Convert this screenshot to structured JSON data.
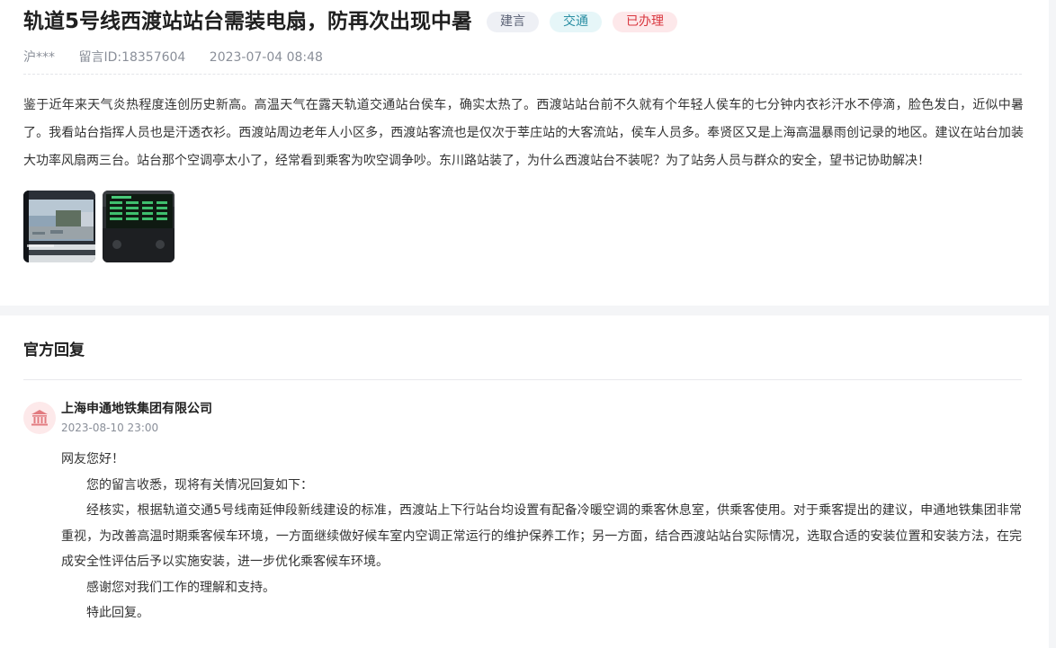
{
  "post": {
    "title": "轨道5号线西渡站站台需装电扇，防再次出现中暑",
    "tags": [
      "建言",
      "交通",
      "已办理"
    ],
    "author": "沪***",
    "message_id": "留言ID:18357604",
    "datetime": "2023-07-04 08:48",
    "content": "鉴于近年来天气炎热程度连创历史新高。高温天气在露天轨道交通站台侯车，确实太热了。西渡站站台前不久就有个年轻人侯车的七分钟内衣衫汗水不停滴，脸色发白，近似中暑了。我看站台指挥人员也是汗透衣衫。西渡站周边老年人小区多，西渡站客流也是仅次于莘庄站的大客流站，侯车人员多。奉贤区又是上海高温暴雨创记录的地区。建议在站台加装大功率风扇两三台。站台那个空调亭太小了，经常看到乘客为吹空调争吵。东川路站装了，为什么西渡站台不装呢？为了站务人员与群众的安全，望书记协助解决！",
    "images": [
      "station-window-photo",
      "station-display-photo"
    ]
  },
  "reply": {
    "section_title": "官方回复",
    "org_name": "上海申通地铁集团有限公司",
    "org_icon": "building-icon",
    "date": "2023-08-10 23:00",
    "paragraphs": [
      "网友您好！",
      "您的留言收悉，现将有关情况回复如下：",
      "经核实，根据轨道交通5号线南延伸段新线建设的标准，西渡站上下行站台均设置有配备冷暖空调的乘客休息室，供乘客使用。对于乘客提出的建议，申通地铁集团非常重视，为改善高温时期乘客候车环境，一方面继续做好候车室内空调正常运行的维护保养工作；另一方面，结合西渡站站台实际情况，选取合适的安装位置和安装方法，在完成安全性评估后予以实施安装，进一步优化乘客候车环境。",
      "感谢您对我们工作的理解和支持。",
      "特此回复。"
    ]
  },
  "colors": {
    "tag_suggest_bg": "#eef0f5",
    "tag_traffic_bg": "#e6f6f8",
    "tag_done_bg": "#fde8ea",
    "tag_done_text": "#d9363e"
  }
}
